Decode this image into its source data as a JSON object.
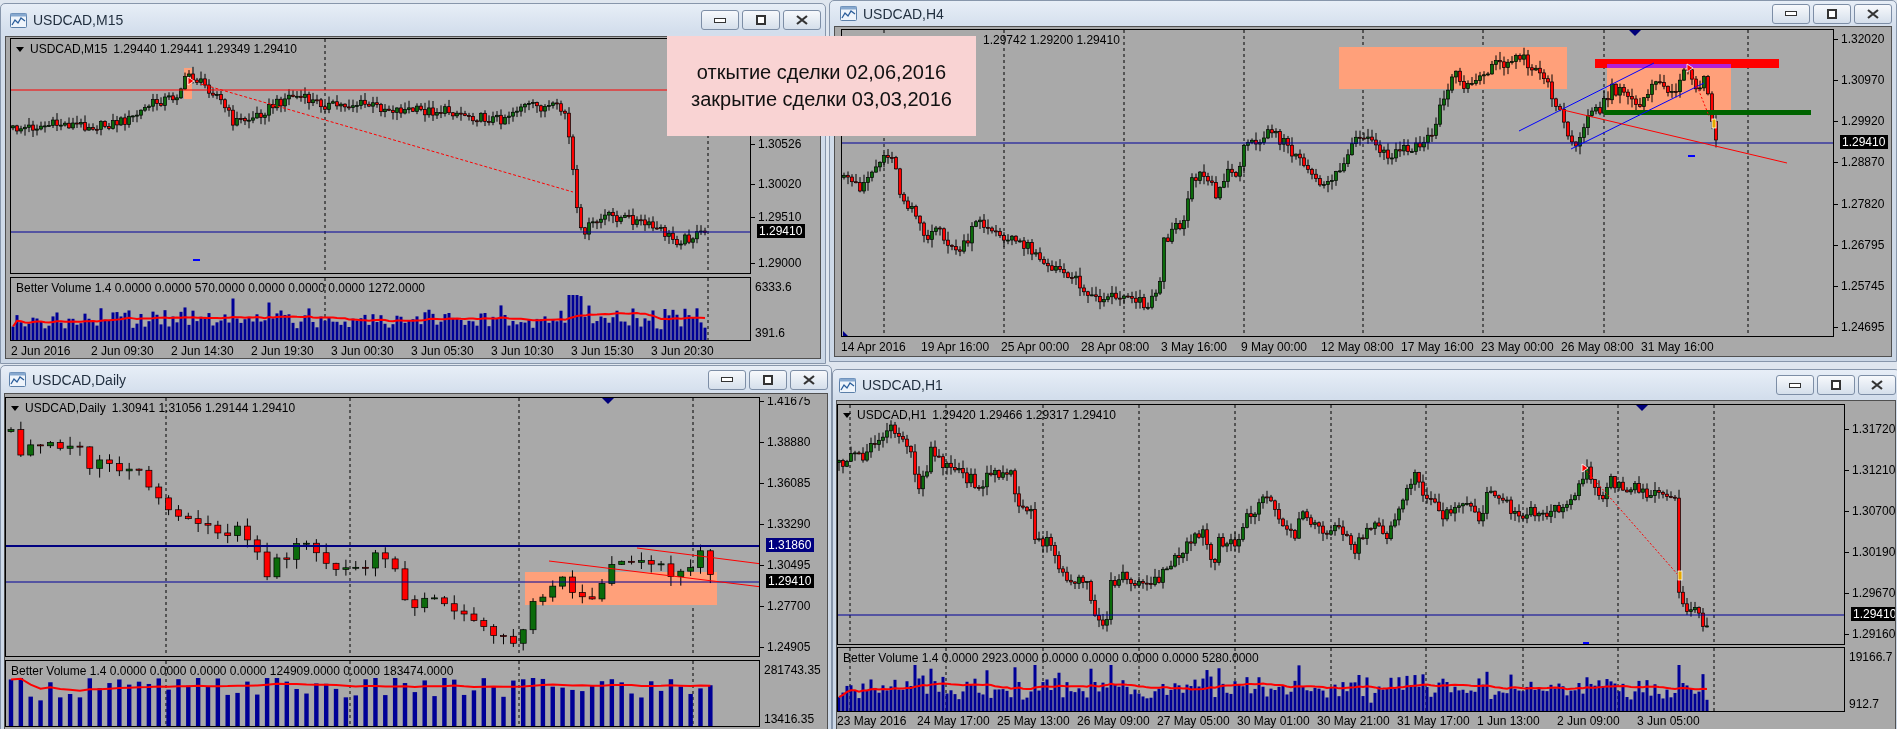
{
  "windows": [
    {
      "title": "USDCAD,M15",
      "header": {
        "symbol": "USDCAD,M15",
        "values": "1.29440 1.29441 1.29349 1.29410"
      },
      "price_labels": [
        {
          "text": "1.30526",
          "kind": "tick"
        },
        {
          "text": "1.30020",
          "kind": "tick"
        },
        {
          "text": "1.29510",
          "kind": "tick"
        },
        {
          "text": "1.29410",
          "kind": "current"
        },
        {
          "text": "1.29000",
          "kind": "tick"
        }
      ],
      "indicator": {
        "label": "Better Volume 1.4 0.0000 0.0000 570.0000 0.0000 0.0000 0.0000 1272.0000",
        "scale": [
          "6333.6",
          "391.6"
        ]
      },
      "time_labels": [
        "2 Jun 2016",
        "2 Jun 09:30",
        "2 Jun 14:30",
        "2 Jun 19:30",
        "3 Jun 00:30",
        "3 Jun 05:30",
        "3 Jun 10:30",
        "3 Jun 15:30",
        "3 Jun 20:30"
      ]
    },
    {
      "title": "USDCAD,H4",
      "header": {
        "values": "1.29742 1.29200 1.29410"
      },
      "price_labels": [
        {
          "text": "1.32020",
          "kind": "tick"
        },
        {
          "text": "1.30970",
          "kind": "tick"
        },
        {
          "text": "1.29920",
          "kind": "tick"
        },
        {
          "text": "1.29410",
          "kind": "current"
        },
        {
          "text": "1.28870",
          "kind": "tick"
        },
        {
          "text": "1.27820",
          "kind": "tick"
        },
        {
          "text": "1.26795",
          "kind": "tick"
        },
        {
          "text": "1.25745",
          "kind": "tick"
        },
        {
          "text": "1.24695",
          "kind": "tick"
        }
      ],
      "time_labels": [
        "14 Apr 2016",
        "19 Apr 16:00",
        "25 Apr 00:00",
        "28 Apr 08:00",
        "3 May 16:00",
        "9 May 00:00",
        "12 May 08:00",
        "17 May 16:00",
        "23 May 00:00",
        "26 May 08:00",
        "31 May 16:00"
      ]
    },
    {
      "title": "USDCAD,Daily",
      "header": {
        "symbol": "USDCAD,Daily",
        "values": "1.30941 1.31056 1.29144 1.29410"
      },
      "price_labels": [
        {
          "text": "1.41675",
          "kind": "tick"
        },
        {
          "text": "1.38880",
          "kind": "tick"
        },
        {
          "text": "1.36085",
          "kind": "tick"
        },
        {
          "text": "1.33290",
          "kind": "tick"
        },
        {
          "text": "1.31860",
          "kind": "level"
        },
        {
          "text": "1.30495",
          "kind": "tick"
        },
        {
          "text": "1.29410",
          "kind": "current"
        },
        {
          "text": "1.27700",
          "kind": "tick"
        },
        {
          "text": "1.24905",
          "kind": "tick"
        }
      ],
      "indicator": {
        "label": "Better Volume 1.4 0.0000 0.0000 0.0000 0.0000 124909.0000 0.0000 183474.0000",
        "scale": [
          "281743.35",
          "13416.35"
        ]
      }
    },
    {
      "title": "USDCAD,H1",
      "header": {
        "symbol": "USDCAD,H1",
        "values": "1.29420 1.29466 1.29317 1.29410"
      },
      "price_labels": [
        {
          "text": "1.31720",
          "kind": "tick"
        },
        {
          "text": "1.31210",
          "kind": "tick"
        },
        {
          "text": "1.30700",
          "kind": "tick"
        },
        {
          "text": "1.30190",
          "kind": "tick"
        },
        {
          "text": "1.29670",
          "kind": "tick"
        },
        {
          "text": "1.29410",
          "kind": "current"
        },
        {
          "text": "1.29160",
          "kind": "tick"
        }
      ],
      "indicator": {
        "label": "Better Volume 1.4 0.0000 2923.0000 0.0000 0.0000 0.0000 0.0000 5280.0000",
        "scale": [
          "19166.7",
          "912.7"
        ]
      },
      "time_labels": [
        "23 May 2016",
        "24 May 17:00",
        "25 May 13:00",
        "26 May 09:00",
        "27 May 05:00",
        "30 May 01:00",
        "30 May 21:00",
        "31 May 17:00",
        "1 Jun 13:00",
        "2 Jun 09:00",
        "3 Jun 05:00"
      ]
    }
  ],
  "note": {
    "lines": [
      "откытие сделки 02,06,2016",
      "закрытие сделки 03,03,2016"
    ]
  }
}
